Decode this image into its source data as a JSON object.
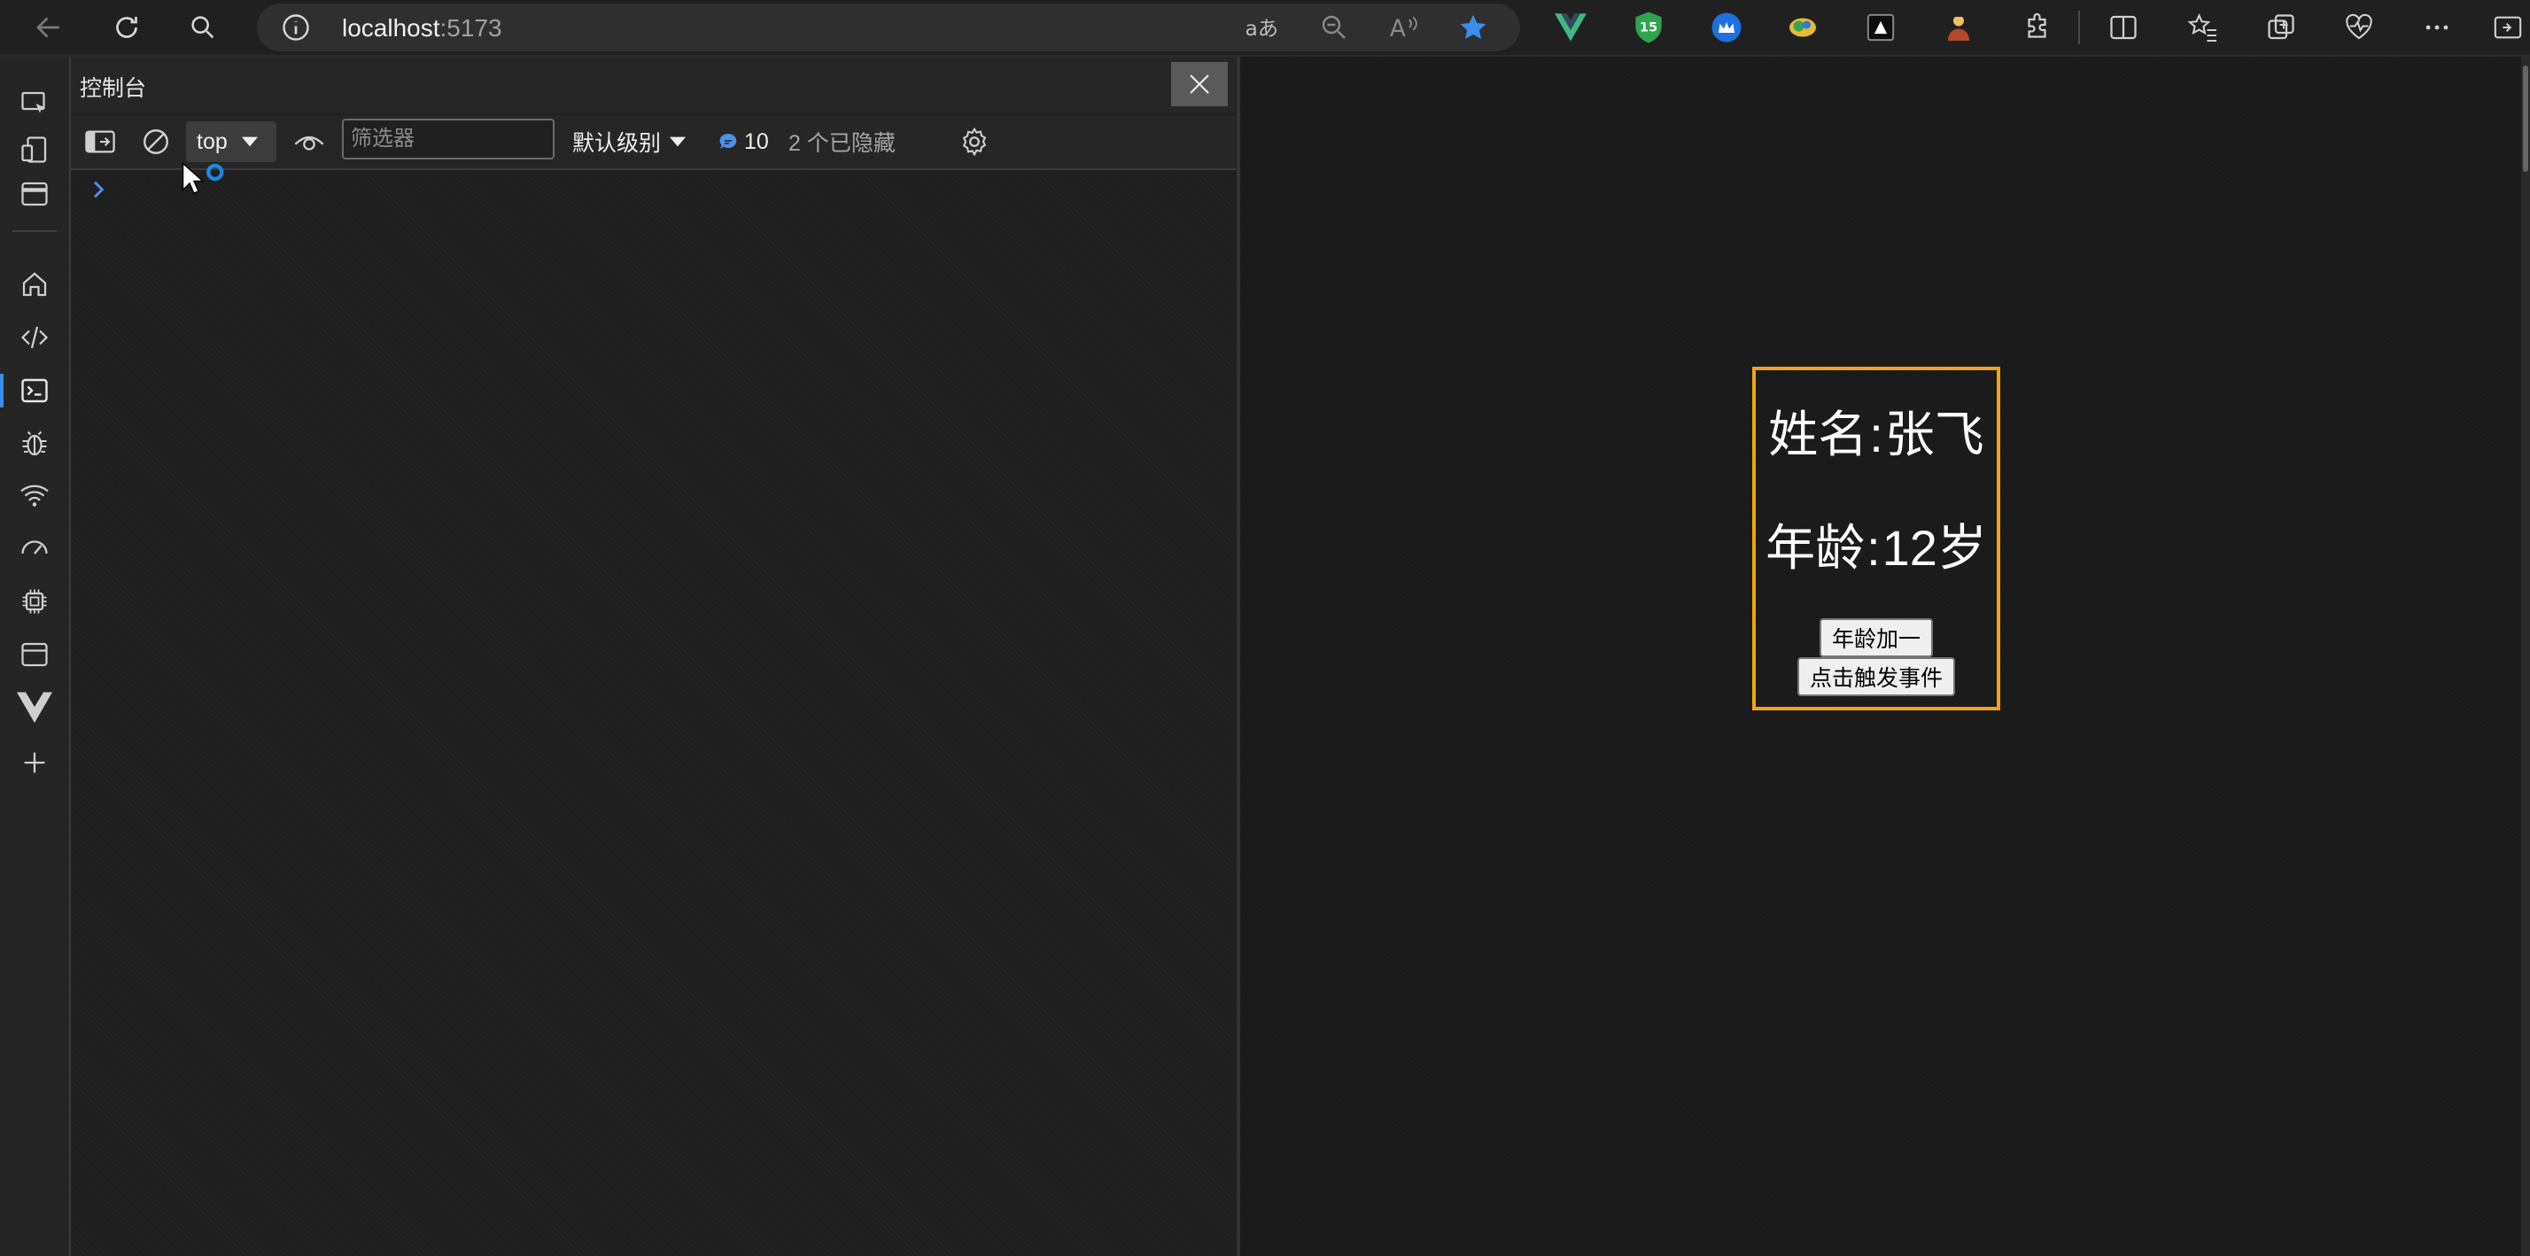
{
  "browser": {
    "url_host": "localhost",
    "url_port": ":5173",
    "colors": {
      "accent": "#3b8eea",
      "favorite_star": "#3b8eea"
    },
    "extensions": [
      "vue-devtools-icon",
      "shield-15-icon",
      "crown-extension-icon",
      "colorful-extension-icon",
      "dark-extension-icon",
      "person-extension-icon"
    ],
    "extension_badge": "15"
  },
  "devtools": {
    "panel_title": "控制台",
    "context": "top",
    "filter_placeholder": "筛选器",
    "level_label": "默认级别",
    "message_count": "10",
    "hidden_label": "2 个已隐藏"
  },
  "app": {
    "name_label": "姓名",
    "name_value": "张飞",
    "age_label": "年龄",
    "age_value": "12岁",
    "btn_age_plus": "年龄加一",
    "btn_trigger_event": "点击触发事件",
    "colors": {
      "card_border": "#f0a31a"
    }
  }
}
